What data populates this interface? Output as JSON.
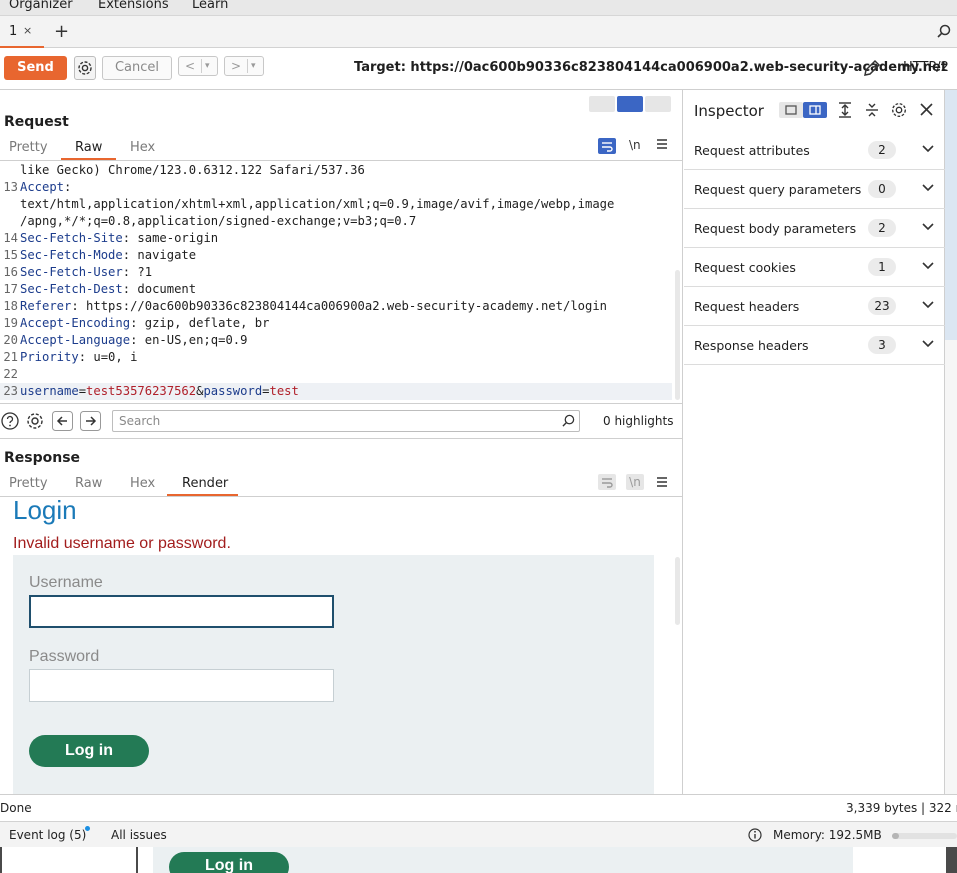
{
  "menu": [
    "Organizer",
    "Extensions",
    "Learn"
  ],
  "tabs": [
    {
      "label": "1",
      "close": "×"
    }
  ],
  "toolbar": {
    "send_label": "Send",
    "cancel_label": "Cancel",
    "back": "<",
    "forward": ">",
    "dropdown": "▾",
    "target_label": "Target: https://0ac600b90336c823804144ca006900a2.web-security-academy.net",
    "protocol": "HTTP/2"
  },
  "request": {
    "title": "Request",
    "tabs": [
      "Pretty",
      "Raw",
      "Hex"
    ],
    "active_tab": "Raw",
    "newline_toggle": "\\n",
    "lines": [
      {
        "n": "",
        "text": "like Gecko) Chrome/123.0.6312.122 Safari/537.36"
      },
      {
        "n": "13",
        "key": "Accept",
        "val": ":"
      },
      {
        "n": "",
        "text": "text/html,application/xhtml+xml,application/xml;q=0.9,image/avif,image/webp,image"
      },
      {
        "n": "",
        "text": "/apng,*/*;q=0.8,application/signed-exchange;v=b3;q=0.7"
      },
      {
        "n": "14",
        "key": "Sec-Fetch-Site",
        "val": ": same-origin"
      },
      {
        "n": "15",
        "key": "Sec-Fetch-Mode",
        "val": ": navigate"
      },
      {
        "n": "16",
        "key": "Sec-Fetch-User",
        "val": ": ?1"
      },
      {
        "n": "17",
        "key": "Sec-Fetch-Dest",
        "val": ": document"
      },
      {
        "n": "18",
        "key": "Referer",
        "val": ": https://0ac600b90336c823804144ca006900a2.web-security-academy.net/login"
      },
      {
        "n": "19",
        "key": "Accept-Encoding",
        "val": ": gzip, deflate, br"
      },
      {
        "n": "20",
        "key": "Accept-Language",
        "val": ": en-US,en;q=0.9"
      },
      {
        "n": "21",
        "key": "Priority",
        "val": ": u=0, i"
      },
      {
        "n": "22",
        "text": ""
      }
    ],
    "body_line": {
      "n": "23",
      "k1": "username",
      "eq1": "=",
      "v1": "test53576237562",
      "amp": "&",
      "k2": "password",
      "eq2": "=",
      "v2": "test"
    }
  },
  "search": {
    "placeholder": "Search",
    "highlights": "0 highlights"
  },
  "response": {
    "title": "Response",
    "tabs": [
      "Pretty",
      "Raw",
      "Hex",
      "Render"
    ],
    "active_tab": "Render",
    "newline_toggle": "\\n",
    "render": {
      "heading": "Login",
      "error": "Invalid username or password.",
      "username_label": "Username",
      "password_label": "Password",
      "login_button": "Log in"
    }
  },
  "inspector": {
    "title": "Inspector",
    "rows": [
      {
        "label": "Request attributes",
        "count": "2"
      },
      {
        "label": "Request query parameters",
        "count": "0"
      },
      {
        "label": "Request body parameters",
        "count": "2"
      },
      {
        "label": "Request cookies",
        "count": "1"
      },
      {
        "label": "Request headers",
        "count": "23"
      },
      {
        "label": "Response headers",
        "count": "3"
      }
    ]
  },
  "status": {
    "done": "Done",
    "bytes": "3,339 bytes | 322 m"
  },
  "bottom": {
    "event_log": "Event log (5)",
    "all_issues": "All issues",
    "memory": "Memory: 192.5MB",
    "memory_fraction": 0.1
  },
  "colors": {
    "accent": "#e8662f",
    "login_blue": "#1b7ab8",
    "error_red": "#a21d1d",
    "button_green": "#237a55",
    "toggle_blue": "#3b66c4"
  },
  "background_button": "Log in"
}
